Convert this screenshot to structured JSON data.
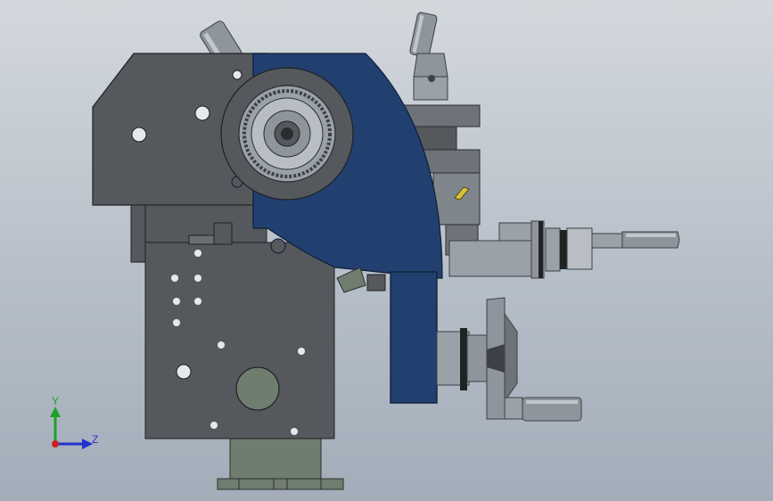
{
  "triad": {
    "y_label": "Y",
    "z_label": "Z",
    "y_color": "#1fa12a",
    "z_color": "#2233cc",
    "x_color": "#cc1f1f"
  },
  "colors": {
    "background_top": "#d3d8dd",
    "background_bottom": "#a3adb9",
    "body_gray": "#55585d",
    "carriage_blue": "#22406f",
    "base_green": "#6f7d6f",
    "steel_light": "#9ca3aa",
    "steel_mid": "#6d7379",
    "steel_dark": "#3d4044",
    "accent_yellow": "#d8c23a"
  }
}
